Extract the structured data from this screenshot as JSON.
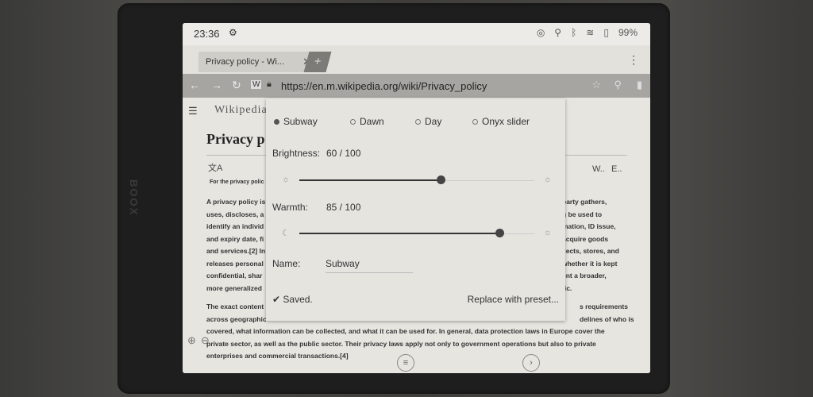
{
  "statusbar": {
    "time": "23:36",
    "battery": "99%",
    "icons": [
      "settings-icon",
      "sync-icon",
      "bulb-icon",
      "bluetooth-icon",
      "wifi-icon",
      "battery-icon"
    ]
  },
  "tabs": {
    "active_tab_label": "Privacy policy - Wi...",
    "close_glyph": "✕",
    "new_tab_glyph": "+",
    "menu_glyph": "⋮"
  },
  "urlbar": {
    "url": "https://en.m.wikipedia.org/wiki/Privacy_policy"
  },
  "page": {
    "wordmark": "Wikipedia",
    "title": "Privacy p",
    "hatnote": "For the privacy polic",
    "para1_left": [
      "A privacy policy is",
      "uses, discloses, a",
      "identify an individ",
      "and expiry date, fi",
      "and services.[2] In",
      "releases personal",
      "confidential, shar",
      "more generalized"
    ],
    "para1_right": [
      "party gathers,",
      "g be used to",
      "mation, ID issue,",
      "acquire goods",
      "llects, stores, and",
      "whether it is kept",
      "ent a broader,",
      "fic."
    ],
    "para2_lines": [
      "The exact content",
      "across geographic",
      "covered, what information can be collected, and what it can be used for. In general, data protection laws in Europe cover the",
      "private sector, as well as the public sector. Their privacy laws apply not only to government operations but also to private",
      "enterprises and commercial transactions.[4]"
    ],
    "para2_right": [
      "s requirements",
      "delines of who is"
    ],
    "header_icons": [
      "menu-icon",
      "language-icon",
      "watch-icon",
      "edit-icon"
    ],
    "header_icon_labels": [
      "W..",
      "E.."
    ]
  },
  "popup": {
    "presets": [
      {
        "label": "Subway",
        "selected": true
      },
      {
        "label": "Dawn",
        "selected": false
      },
      {
        "label": "Day",
        "selected": false
      },
      {
        "label": "Onyx slider",
        "selected": false
      }
    ],
    "brightness_label": "Brightness:",
    "brightness_value": "60 / 100",
    "brightness_level": 0.6,
    "warmth_label": "Warmth:",
    "warmth_value": "85 / 100",
    "warmth_level": 0.85,
    "name_label": "Name:",
    "name_value": "Subway",
    "saved_text": "✔ Saved.",
    "replace_text": "Replace with preset..."
  }
}
